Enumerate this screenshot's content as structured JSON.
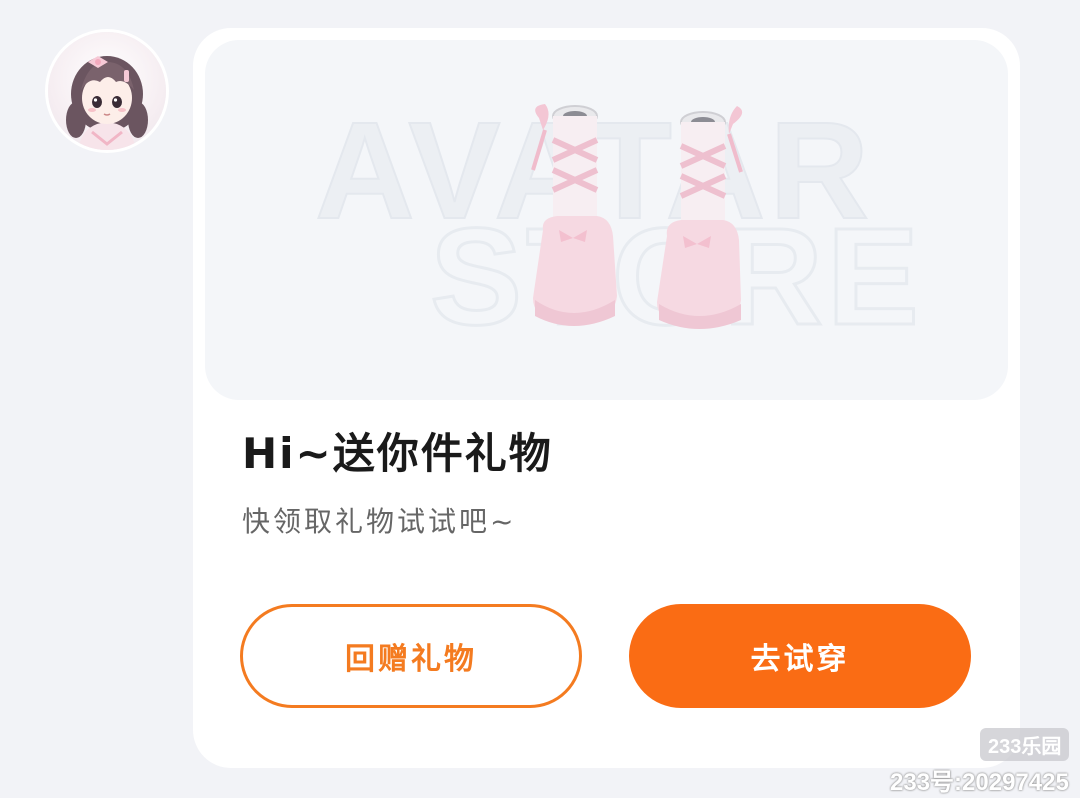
{
  "gift_card": {
    "banner_watermark_line1": "AVATAR",
    "banner_watermark_line2": "STORE",
    "title": "Hi~送你件礼物",
    "subtitle": "快领取礼物试试吧~",
    "return_gift_label": "回赠礼物",
    "try_on_label": "去试穿"
  },
  "icons": {
    "sender_avatar": "girl-avatar",
    "gift_item": "pink-boots-icon"
  },
  "colors": {
    "accent": "#fa6c14",
    "outline": "#f47b20",
    "title": "#1a1a1a",
    "subtitle": "#666666",
    "card_bg": "#ffffff",
    "page_bg": "#f2f3f7"
  },
  "watermarks": {
    "brand": "233乐园",
    "user_id": "233号:20297425"
  }
}
